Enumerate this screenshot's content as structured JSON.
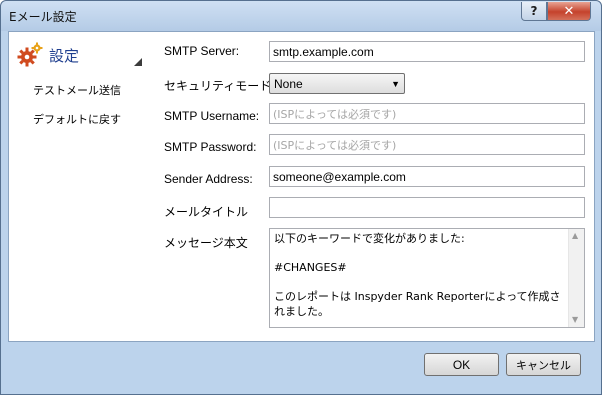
{
  "window": {
    "title": "Eメール設定",
    "help_label": "?",
    "close_label": "✕"
  },
  "nav": {
    "active_label": "設定",
    "items": [
      {
        "label": "テストメール送信"
      },
      {
        "label": "デフォルトに戻す"
      }
    ]
  },
  "form": {
    "smtp_server": {
      "label": "SMTP Server:",
      "value": "smtp.example.com"
    },
    "security_mode": {
      "label": "セキュリティモード",
      "value": "None"
    },
    "smtp_username": {
      "label": "SMTP Username:",
      "value": "",
      "placeholder": "(ISPによっては必須です)"
    },
    "smtp_password": {
      "label": "SMTP Password:",
      "value": "",
      "placeholder": "(ISPによっては必須です)"
    },
    "sender_address": {
      "label": "Sender Address:",
      "value": "someone@example.com"
    },
    "mail_title": {
      "label": "メールタイトル",
      "value": ""
    },
    "message_body": {
      "label": "メッセージ本文",
      "value": "以下のキーワードで変化がありました:\n\n#CHANGES#\n\nこのレポートは Inspyder Rank Reporterによって作成されました。"
    }
  },
  "buttons": {
    "ok": "OK",
    "cancel": "キャンセル"
  },
  "colors": {
    "frame": "#bcd3ec",
    "close_button": "#c5422c",
    "nav_active_text": "#1f3f8f"
  }
}
